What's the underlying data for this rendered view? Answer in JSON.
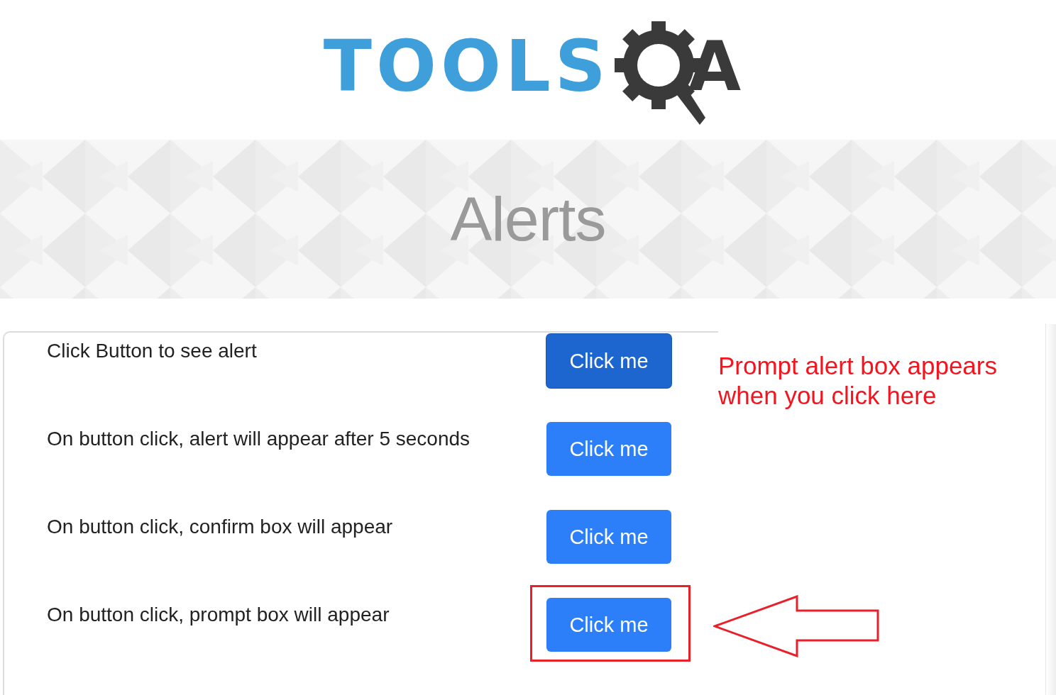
{
  "logo": {
    "text": "TOOLS",
    "suffix": "A"
  },
  "banner": {
    "title": "Alerts"
  },
  "rows": [
    {
      "label": "Click Button to see alert",
      "button": "Click me",
      "focused": true,
      "highlighted": false
    },
    {
      "label": "On button click, alert will appear after 5 seconds",
      "button": "Click me",
      "focused": false,
      "highlighted": false
    },
    {
      "label": "On button click, confirm box will appear",
      "button": "Click me",
      "focused": false,
      "highlighted": false
    },
    {
      "label": "On button click, prompt box will appear",
      "button": "Click me",
      "focused": false,
      "highlighted": true
    }
  ],
  "annotation": {
    "text": "Prompt alert box appears when you click here"
  }
}
